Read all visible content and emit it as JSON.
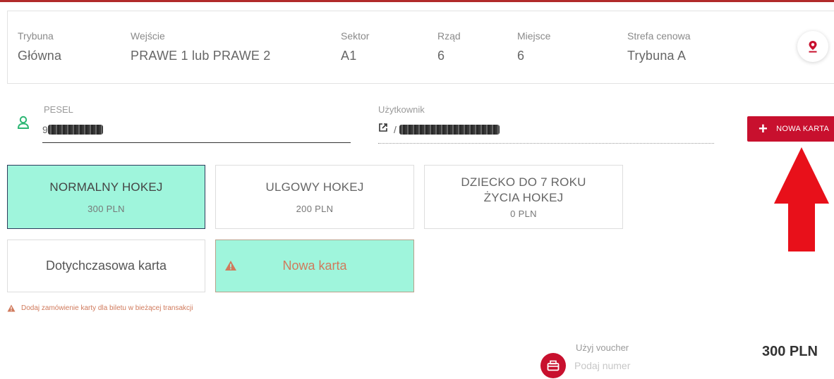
{
  "seat": {
    "columns": [
      {
        "label": "Trybuna",
        "value": "Główna"
      },
      {
        "label": "Wejście",
        "value": "PRAWE 1 lub PRAWE 2"
      },
      {
        "label": "Sektor",
        "value": "A1"
      },
      {
        "label": "Rząd",
        "value": "6"
      },
      {
        "label": "Miejsce",
        "value": "6"
      },
      {
        "label": "Strefa cenowa",
        "value": "Trybuna A"
      }
    ],
    "pin_icon": "map-pin-icon"
  },
  "form": {
    "pesel_label": "PESEL",
    "pesel_value": "9",
    "user_label": "Użytkownik",
    "user_value": "/",
    "new_card_button": "NOWA KARTA",
    "person_icon": "person-icon",
    "edit_icon": "external-link-icon"
  },
  "tickets": [
    {
      "name": "NORMALNY HOKEJ",
      "price": "300 PLN",
      "selected": true
    },
    {
      "name": "ULGOWY HOKEJ",
      "price": "200 PLN",
      "selected": false
    },
    {
      "name": "DZIECKO DO 7 ROKU ŻYCIA HOKEJ",
      "price": "0 PLN",
      "selected": false
    }
  ],
  "card_options": {
    "existing_label": "Dotychczasowa karta",
    "new_label": "Nowa karta"
  },
  "warning_note": "Dodaj zamówienie karty dla biletu w bieżącej transakcji",
  "voucher": {
    "label": "Użyj voucher",
    "placeholder": "Podaj numer"
  },
  "total": "300 PLN",
  "colors": {
    "accent_red": "#c8102e",
    "selected_tile": "#9ff5dc",
    "warning": "#d07a5c",
    "annotation_arrow": "#e8101a"
  }
}
